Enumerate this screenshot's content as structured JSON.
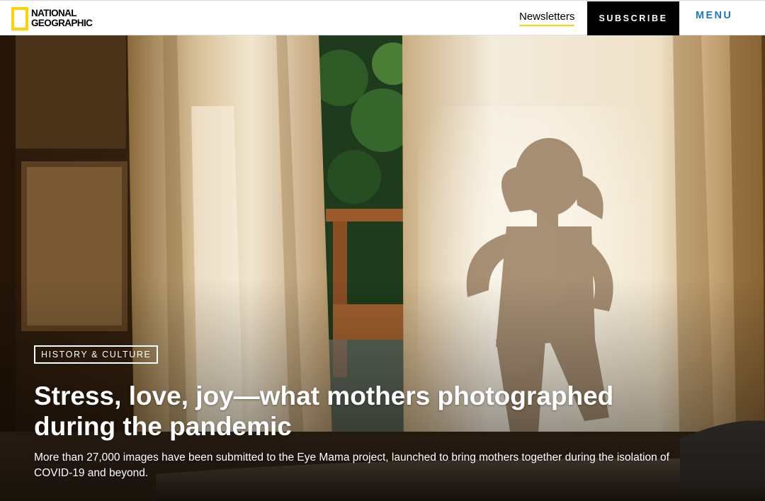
{
  "header": {
    "logo_line1": "NATIONAL",
    "logo_line2": "GEOGRAPHIC",
    "newsletters_label": "Newsletters",
    "subscribe_label": "SUBSCRIBE",
    "menu_label": "MENU",
    "accent_color": "#ffd200",
    "menu_color": "#1a78c2"
  },
  "hero": {
    "category": "HISTORY & CULTURE",
    "headline": "Stress, love, joy—what mothers photographed during the pandemic",
    "dek": "More than 27,000 images have been submitted to the Eye Mama project, launched to bring mothers together during the isolation of COVID-19 and beyond."
  }
}
